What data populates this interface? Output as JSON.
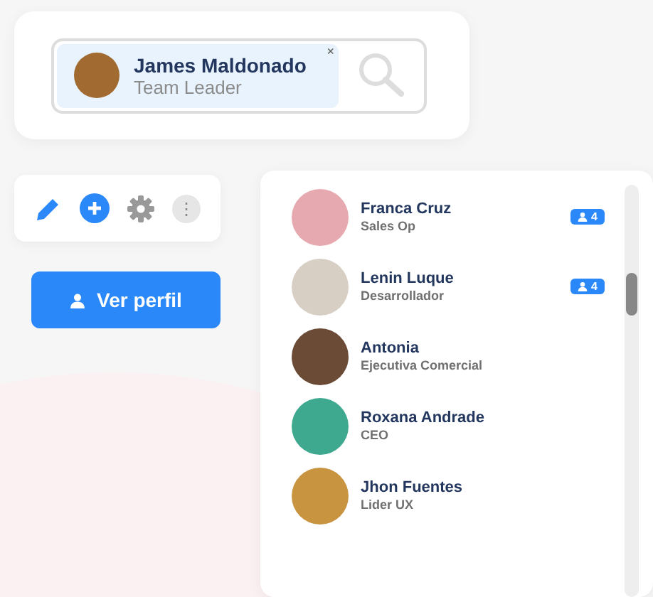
{
  "selected_user": {
    "name": "James Maldonado",
    "role": "Team Leader",
    "remove": "×"
  },
  "toolbar": {
    "menu": "⋮"
  },
  "profile_button": {
    "label": "Ver perfil"
  },
  "people": [
    {
      "name": "Franca Cruz",
      "role": "Sales Op",
      "badge": "4"
    },
    {
      "name": "Lenin Luque",
      "role": "Desarrollador",
      "badge": "4"
    },
    {
      "name": "Antonia",
      "role": "Ejecutiva Comercial"
    },
    {
      "name": "Roxana Andrade",
      "role": "CEO"
    },
    {
      "name": "Jhon Fuentes",
      "role": "Lider UX"
    }
  ]
}
